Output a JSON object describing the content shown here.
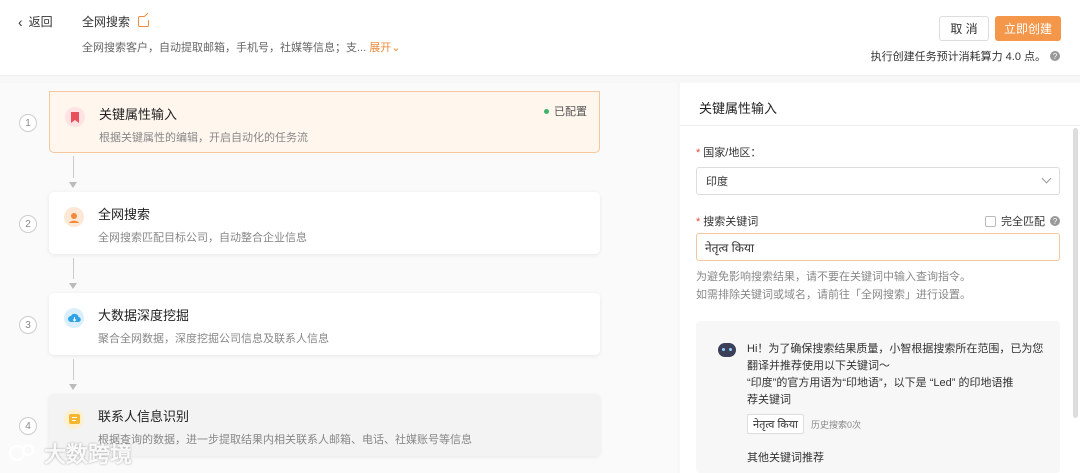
{
  "header": {
    "back_label": "返回",
    "task_title": "全网搜索",
    "task_desc": "全网搜索客户，自动提取邮箱，手机号，社媒等信息；支...",
    "expand_label": "展开",
    "cancel_label": "取 消",
    "create_label": "立即创建",
    "cost_note": "执行创建任务预计消耗算力 4.0 点。"
  },
  "steps": [
    {
      "num": "1",
      "title": "关键属性输入",
      "desc": "根据关键属性的编辑，开启自动化的任务流",
      "badge": "已配置",
      "icon": "bookmark-icon",
      "icon_color": "#e8505b",
      "state": "active"
    },
    {
      "num": "2",
      "title": "全网搜索",
      "desc": "全网搜索匹配目标公司，自动整合企业信息",
      "icon": "search-person-icon",
      "icon_color": "#f08a3c"
    },
    {
      "num": "3",
      "title": "大数据深度挖掘",
      "desc": "聚合全网数据，深度挖掘公司信息及联系人信息",
      "icon": "cloud-download-icon",
      "icon_color": "#2fa3e6"
    },
    {
      "num": "4",
      "title": "联系人信息识别",
      "desc": "根据查询的数据，进一步提取结果内相关联系人邮箱、电话、社媒账号等信息",
      "icon": "contact-card-icon",
      "icon_color": "#f5b731",
      "state": "dim"
    }
  ],
  "panel": {
    "title": "关键属性输入",
    "country_label": "国家/地区：",
    "country_value": "印度",
    "keyword_label": "搜索关键词",
    "exact_match_label": "完全匹配",
    "keyword_value": "नेतृत्व किया",
    "hint_line1": "为避免影响搜索结果，请不要在关键词中输入查询指令。",
    "hint_line2": "如需排除关键词或域名，请前往「全网搜索」进行设置。",
    "ai_line1": "Hi！为了确保搜索结果质量，小智根据搜索所在范围，已为您",
    "ai_line2": "翻译并推荐使用以下关键词～",
    "ai_line3": "“印度”的官方用语为“印地语”，以下是 “Led” 的印地语推",
    "ai_line4": "荐关键词",
    "tag_value": "नेतृत्व किया",
    "tag_meta": "历史搜索0次",
    "other_kw_label": "其他关键词推荐"
  },
  "watermark": "大数跨境",
  "colors": {
    "accent": "#f5974a",
    "active_bg": "#fff6ee",
    "configured": "#3fb36b"
  }
}
